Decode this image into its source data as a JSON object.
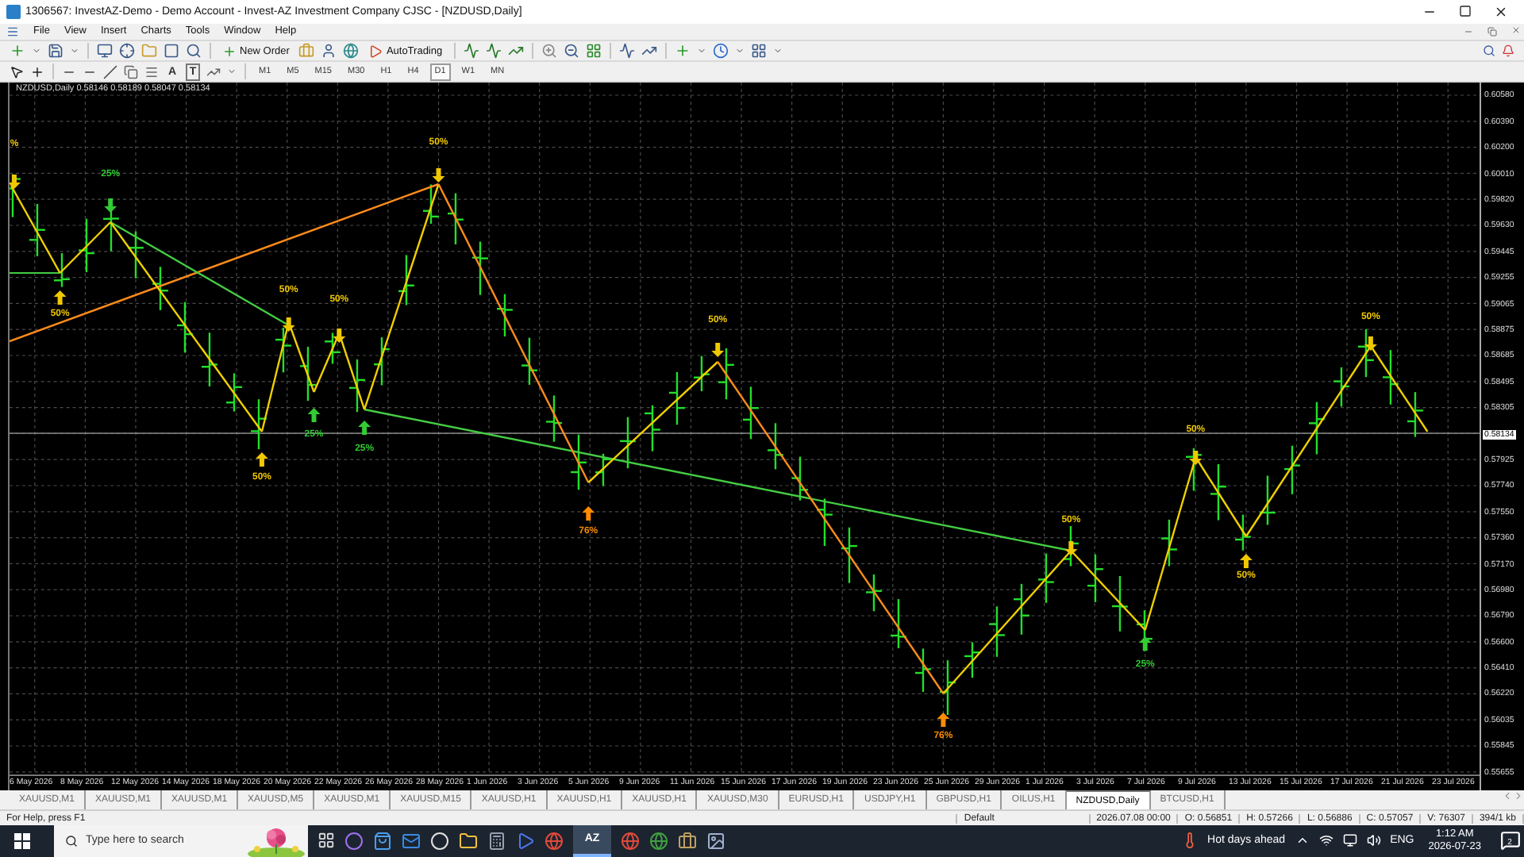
{
  "window": {
    "title": "1306567: InvestAZ-Demo - Demo Account - Invest-AZ Investment Company CJSC - [NZDUSD,Daily]"
  },
  "menu": [
    "File",
    "View",
    "Insert",
    "Charts",
    "Tools",
    "Window",
    "Help"
  ],
  "toolbar": {
    "new_order": "New Order",
    "auto_trading": "AutoTrading",
    "text_tool": "A",
    "label_tool": "T"
  },
  "timeframes": [
    {
      "label": "M1",
      "selected": false
    },
    {
      "label": "M5",
      "selected": false
    },
    {
      "label": "M15",
      "selected": false
    },
    {
      "label": "M30",
      "selected": false
    },
    {
      "label": "H1",
      "selected": false
    },
    {
      "label": "H4",
      "selected": false
    },
    {
      "label": "D1",
      "selected": true
    },
    {
      "label": "W1",
      "selected": false
    },
    {
      "label": "MN",
      "selected": false
    }
  ],
  "chart": {
    "header": "NZDUSD,Daily  0.58146 0.58189 0.58047 0.58134",
    "price_labels": [
      {
        "text": "0.60580",
        "kind": "tick"
      },
      {
        "text": "0.60390",
        "kind": "tick"
      },
      {
        "text": "0.60200",
        "kind": "tick"
      },
      {
        "text": "0.60010",
        "kind": "tick"
      },
      {
        "text": "0.59820",
        "kind": "tick"
      },
      {
        "text": "0.59630",
        "kind": "tick"
      },
      {
        "text": "0.59445",
        "kind": "tick"
      },
      {
        "text": "0.59255",
        "kind": "tick"
      },
      {
        "text": "0.59065",
        "kind": "tick"
      },
      {
        "text": "0.58875",
        "kind": "tick"
      },
      {
        "text": "0.58685",
        "kind": "tick"
      },
      {
        "text": "0.58495",
        "kind": "tick"
      },
      {
        "text": "0.58305",
        "kind": "tick"
      },
      {
        "text": "0.58134",
        "kind": "current"
      },
      {
        "text": "0.57925",
        "kind": "tick"
      },
      {
        "text": "0.57740",
        "kind": "tick"
      },
      {
        "text": "0.57550",
        "kind": "tick"
      },
      {
        "text": "0.57360",
        "kind": "tick"
      },
      {
        "text": "0.57170",
        "kind": "tick"
      },
      {
        "text": "0.56980",
        "kind": "tick"
      },
      {
        "text": "0.56790",
        "kind": "tick"
      },
      {
        "text": "0.56600",
        "kind": "tick"
      },
      {
        "text": "0.56410",
        "kind": "tick"
      },
      {
        "text": "0.56220",
        "kind": "tick"
      },
      {
        "text": "0.56035",
        "kind": "tick"
      },
      {
        "text": "0.55845",
        "kind": "tick"
      },
      {
        "text": "0.55655",
        "kind": "tick"
      }
    ],
    "dates": [
      "6 May 2026",
      "8 May 2026",
      "12 May 2026",
      "14 May 2026",
      "18 May 2026",
      "20 May 2026",
      "22 May 2026",
      "26 May 2026",
      "28 May 2026",
      "1 Jun 2026",
      "3 Jun 2026",
      "5 Jun 2026",
      "9 Jun 2026",
      "11 Jun 2026",
      "15 Jun 2026",
      "17 Jun 2026",
      "19 Jun 2026",
      "23 Jun 2026",
      "25 Jun 2026",
      "29 Jun 2026",
      "1 Jul 2026",
      "3 Jul 2026",
      "7 Jul 2026",
      "9 Jul 2026",
      "13 Jul 2026",
      "15 Jul 2026",
      "17 Jul 2026",
      "21 Jul 2026",
      "23 Jul 2026"
    ],
    "markers": [
      {
        "text": "%",
        "kind": "down",
        "color": "#f0c800"
      },
      {
        "text": "25%",
        "kind": "down",
        "color": "#33cc33"
      },
      {
        "text": "50%",
        "kind": "up",
        "color": "#f0c800"
      },
      {
        "text": "50%",
        "kind": "down",
        "color": "#f0c800"
      },
      {
        "text": "50%",
        "kind": "down",
        "color": "#f0c800"
      },
      {
        "text": "50%",
        "kind": "up",
        "color": "#f0c800"
      },
      {
        "text": "25%",
        "kind": "up",
        "color": "#33cc33"
      },
      {
        "text": "25%",
        "kind": "up",
        "color": "#33cc33"
      },
      {
        "text": "50%",
        "kind": "down",
        "color": "#f0c800"
      },
      {
        "text": "76%",
        "kind": "up",
        "color": "#ff8c00"
      },
      {
        "text": "50%",
        "kind": "down",
        "color": "#f0c800"
      },
      {
        "text": "76%",
        "kind": "up",
        "color": "#ff8c00"
      },
      {
        "text": "50%",
        "kind": "down",
        "color": "#f0c800"
      },
      {
        "text": "25%",
        "kind": "up",
        "color": "#33cc33"
      },
      {
        "text": "50%",
        "kind": "down",
        "color": "#f0c800"
      },
      {
        "text": "50%",
        "kind": "up",
        "color": "#f0c800"
      },
      {
        "text": "50%",
        "kind": "down",
        "color": "#f0c800"
      }
    ]
  },
  "tabs": [
    {
      "label": "XAUUSD,M1",
      "selected": false
    },
    {
      "label": "XAUUSD,M1",
      "selected": false
    },
    {
      "label": "XAUUSD,M1",
      "selected": false
    },
    {
      "label": "XAUUSD,M5",
      "selected": false
    },
    {
      "label": "XAUUSD,M1",
      "selected": false
    },
    {
      "label": "XAUUSD,M15",
      "selected": false
    },
    {
      "label": "XAUUSD,H1",
      "selected": false
    },
    {
      "label": "XAUUSD,H1",
      "selected": false
    },
    {
      "label": "XAUUSD,H1",
      "selected": false
    },
    {
      "label": "XAUUSD,M30",
      "selected": false
    },
    {
      "label": "EURUSD,H1",
      "selected": false
    },
    {
      "label": "USDJPY,H1",
      "selected": false
    },
    {
      "label": "GBPUSD,H1",
      "selected": false
    },
    {
      "label": "OILUS,H1",
      "selected": false
    },
    {
      "label": "NZDUSD,Daily",
      "selected": true
    },
    {
      "label": "BTCUSD,H1",
      "selected": false
    }
  ],
  "status_bar": {
    "help": "For Help, press F1",
    "profile": "Default",
    "fields": [
      "2026.07.08 00:00",
      "O: 0.56851",
      "H: 0.57266",
      "L: 0.56886",
      "C: 0.57057",
      "V: 76307"
    ],
    "traffic": "394/1 kb"
  },
  "taskbar": {
    "search_placeholder": "Type here to search",
    "app_label": "AZ",
    "weather": "Hot days ahead",
    "language": "ENG",
    "time": "1:12 AM",
    "date": "2026-07-23",
    "notifications": "2"
  }
}
